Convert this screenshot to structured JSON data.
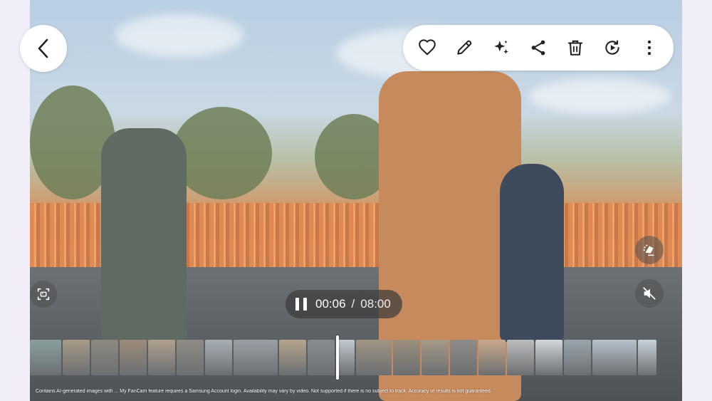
{
  "toolbar": {
    "icons": [
      "heart-icon",
      "pencil-icon",
      "sparkle-icon",
      "share-icon",
      "trash-icon",
      "rotate-icon",
      "more-icon"
    ]
  },
  "playback": {
    "current_time": "00:06",
    "separator": "/",
    "total_time": "08:00",
    "state": "playing"
  },
  "side_controls": {
    "icons": [
      "eraser-icon",
      "mute-icon",
      "capture-icon"
    ]
  },
  "filmstrip": {
    "thumb_colors": [
      "#8aa0a0",
      "#a89a86",
      "#8e8a80",
      "#9c8c7a",
      "#b1a08d",
      "#8f8c84",
      "#a8b0b6",
      "#9aa0a6",
      "#b6a48e",
      "#8a8d90",
      "#c2c9d1",
      "#a19483",
      "#9b8e7d",
      "#a69988",
      "#8e8c88",
      "#c9a88c",
      "#bcbcbc",
      "#d2d6da",
      "#9aa5ad",
      "#b7c2cc",
      "#c9d3db"
    ]
  },
  "disclaimer": "Contains AI-generated images with ... My FanCam feature requires a Samsung Account login. Availability may vary by video. Not supported if there is no subject to track. Accuracy of results is not guaranteed."
}
